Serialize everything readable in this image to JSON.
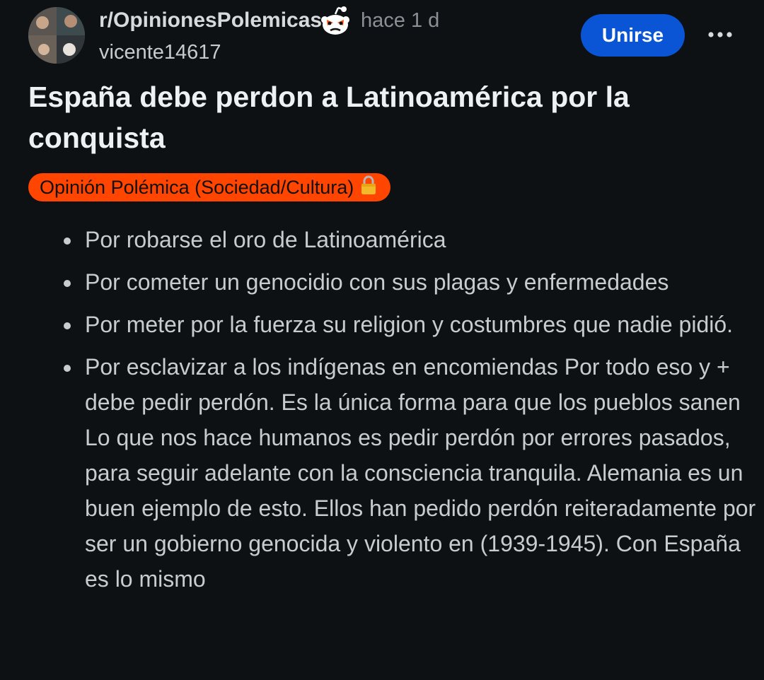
{
  "header": {
    "subreddit": "r/OpinionesPolemicas",
    "time": "hace 1 d",
    "author": "vicente14617",
    "join_label": "Unirse",
    "more_icon": "more-horizontal-icon",
    "mod_icon": "snoo-angry-icon"
  },
  "post": {
    "title": "España debe perdon a Latinoamérica por la conquista",
    "flair": {
      "text": "Opinión Polémica (Sociedad/Cultura)",
      "icon": "lock-icon",
      "color": "#ff4500"
    },
    "items": [
      "Por robarse el oro de Latinoamérica",
      "Por cometer un genocidio con sus plagas y enfermedades",
      "Por meter por la fuerza su religion y costumbres que nadie pidió.",
      "Por esclavizar a los indígenas en encomiendas Por todo eso y + debe pedir perdón. Es la única forma para que los pueblos sanen Lo que nos hace humanos es pedir perdón por errores pasados, para seguir adelante con la consciencia tranquila. Alemania es un buen ejemplo de esto. Ellos han pedido perdón reiteradamente por ser un gobierno genocida y violento en (1939-1945). Con España es lo mismo"
    ]
  },
  "colors": {
    "background": "#0e1113",
    "join_button": "#0a55d6",
    "flair": "#ff4500"
  }
}
